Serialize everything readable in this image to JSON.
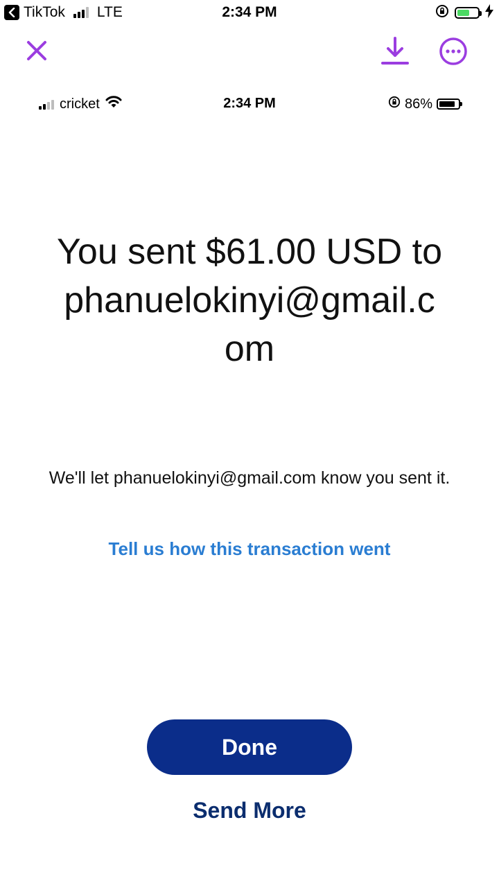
{
  "status_bar": {
    "back_app": "TikTok",
    "network": "LTE",
    "time": "2:34 PM"
  },
  "toolbar": {
    "accent_color": "#9b3de0",
    "icons": [
      "close-icon",
      "download-icon",
      "more-icon"
    ]
  },
  "screenshot_status_bar": {
    "carrier": "cricket",
    "time": "2:34 PM",
    "battery": "86%"
  },
  "confirmation": {
    "headline": "You sent $61.00 USD to phanuelokinyi@gmail.com",
    "message": "We'll let phanuelokinyi@gmail.com know you sent it.",
    "feedback_link": "Tell us how this transaction went",
    "done_label": "Done",
    "send_more_label": "Send More"
  },
  "colors": {
    "primary_button": "#0b2d8a",
    "link": "#2a7dd2",
    "send_more": "#0b2d6e"
  }
}
